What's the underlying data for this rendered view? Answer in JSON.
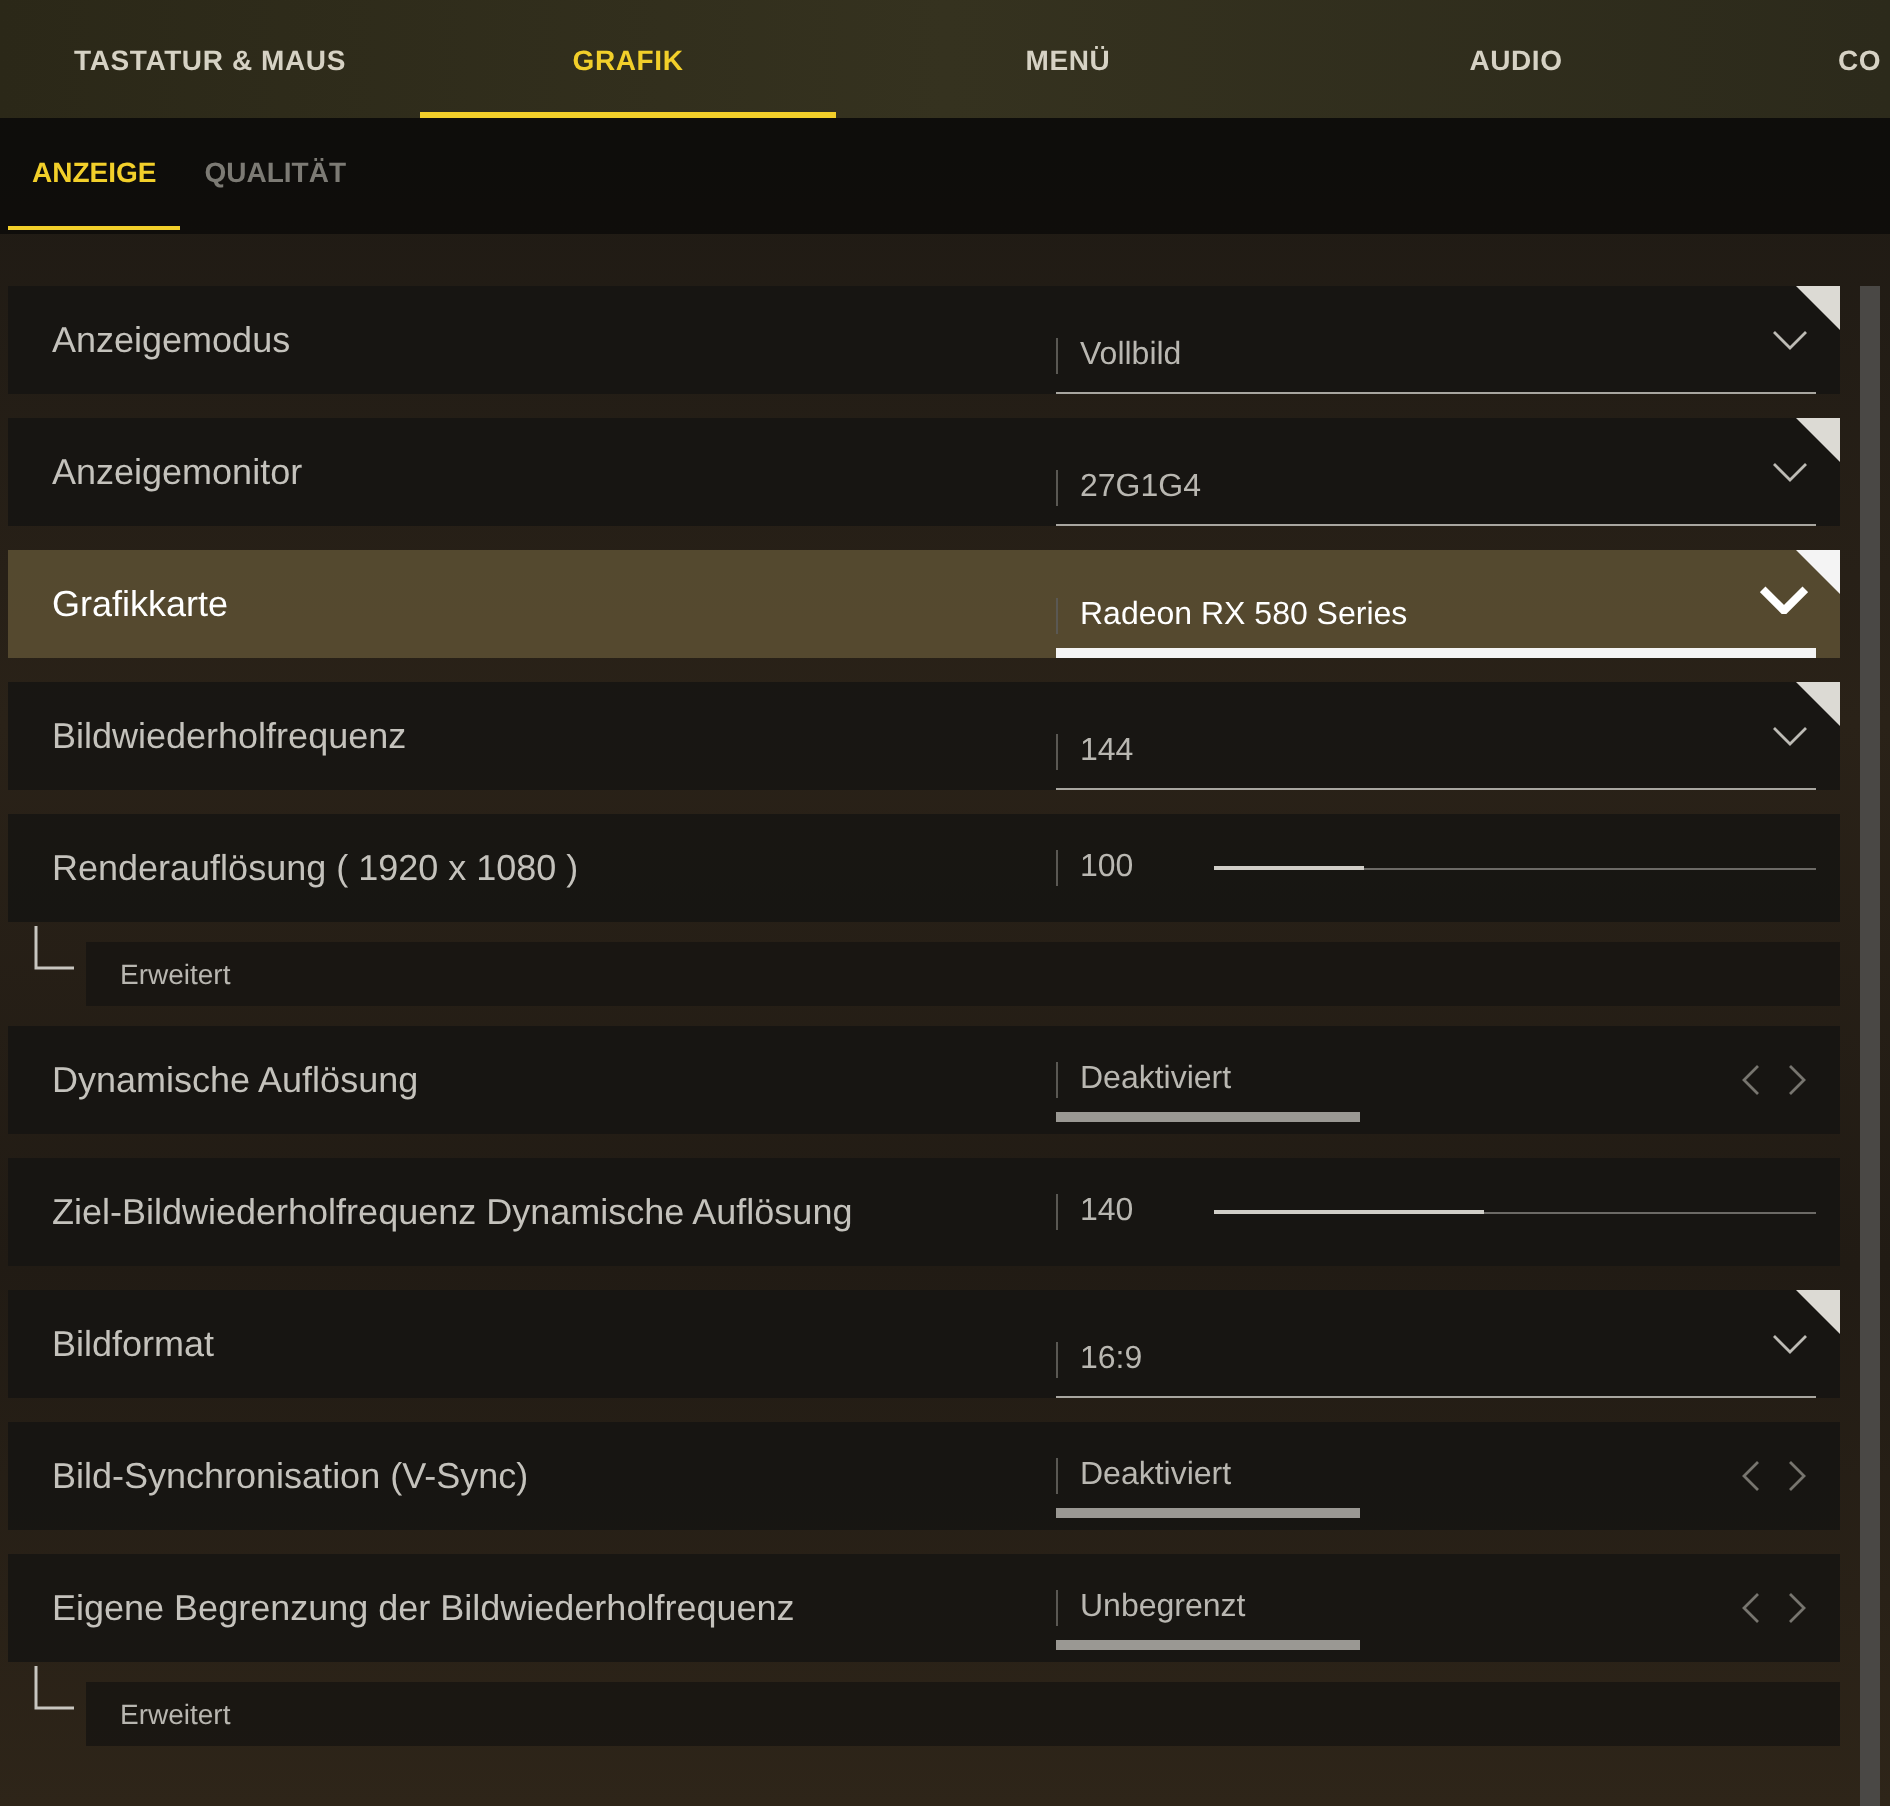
{
  "main_tabs": [
    {
      "label": "TASTATUR & MAUS",
      "selected": false
    },
    {
      "label": "GRAFIK",
      "selected": true
    },
    {
      "label": "MENÜ",
      "selected": false
    },
    {
      "label": "AUDIO",
      "selected": false
    },
    {
      "label": "CO",
      "selected": false
    }
  ],
  "sub_tabs": [
    {
      "label": "ANZEIGE",
      "selected": true
    },
    {
      "label": "QUALITÄT",
      "selected": false
    }
  ],
  "settings": [
    {
      "kind": "dropdown",
      "label": "Anzeigemodus",
      "value": "Vollbild",
      "focused": false
    },
    {
      "kind": "dropdown",
      "label": "Anzeigemonitor",
      "value": "27G1G4",
      "focused": false
    },
    {
      "kind": "dropdown",
      "label": "Grafikkarte",
      "value": "Radeon RX 580 Series",
      "focused": true
    },
    {
      "kind": "dropdown",
      "label": "Bildwiederholfrequenz",
      "value": "144",
      "focused": false
    },
    {
      "kind": "slider",
      "label": "Renderauflösung ( 1920 x 1080 )",
      "value": "100",
      "level": 0.25,
      "focused": false
    },
    {
      "kind": "sub",
      "label": "Erweitert",
      "focused": false
    },
    {
      "kind": "toggle",
      "label": "Dynamische Auflösung",
      "value": "Deaktiviert",
      "focused": false
    },
    {
      "kind": "slider",
      "label": "Ziel-Bildwiederholfrequenz Dynamische Auflösung",
      "value": "140",
      "level": 0.45,
      "focused": false
    },
    {
      "kind": "dropdown",
      "label": "Bildformat",
      "value": "16:9",
      "focused": false
    },
    {
      "kind": "toggle",
      "label": "Bild-Synchronisation (V-Sync)",
      "value": "Deaktiviert",
      "focused": false
    },
    {
      "kind": "toggle",
      "label": "Eigene Begrenzung der Bildwiederholfrequenz",
      "value": "Unbegrenzt",
      "focused": false
    },
    {
      "kind": "sub",
      "label": "Erweitert",
      "focused": false
    }
  ]
}
